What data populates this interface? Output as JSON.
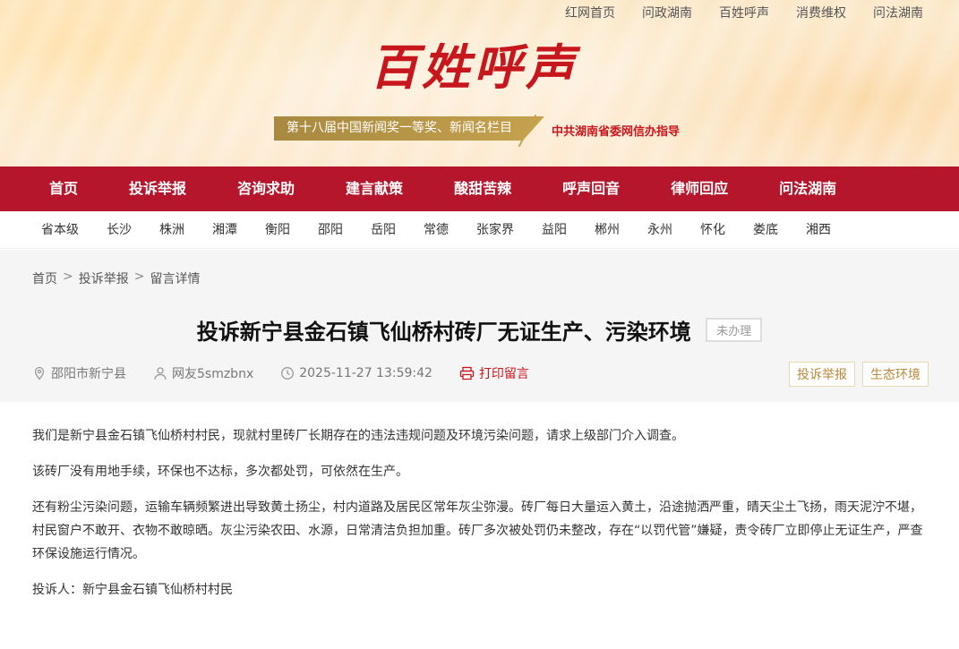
{
  "top_links": [
    "红网首页",
    "问政湖南",
    "百姓呼声",
    "消费维权",
    "问法湖南"
  ],
  "logo_title": "百姓呼声",
  "award_text": "第十八届中国新闻奖一等奖、新闻名栏目",
  "guide_text": "中共湖南省委网信办指导",
  "main_nav": [
    "首页",
    "投诉举报",
    "咨询求助",
    "建言献策",
    "酸甜苦辣",
    "呼声回音",
    "律师回应",
    "问法湖南"
  ],
  "city_nav": [
    "省本级",
    "长沙",
    "株洲",
    "湘潭",
    "衡阳",
    "邵阳",
    "岳阳",
    "常德",
    "张家界",
    "益阳",
    "郴州",
    "永州",
    "怀化",
    "娄底",
    "湘西"
  ],
  "breadcrumb": [
    "首页",
    "投诉举报",
    "留言详情"
  ],
  "breadcrumb_sep": ">",
  "article": {
    "title": "投诉新宁县金石镇飞仙桥村砖厂无证生产、污染环境",
    "status": "未办理",
    "location": "邵阳市新宁县",
    "user": "网友5smzbnx",
    "datetime": "2025-11-27 13:59:42",
    "print_label": "打印留言",
    "tags": [
      "投诉举报",
      "生态环境"
    ],
    "paragraphs": [
      "我们是新宁县金石镇飞仙桥村村民，现就村里砖厂长期存在的违法违规问题及环境污染问题，请求上级部门介入调查。",
      "该砖厂没有用地手续，环保也不达标，多次都处罚，可依然在生产。",
      "还有粉尘污染问题，运输车辆频繁进出导致黄土扬尘，村内道路及居民区常年灰尘弥漫。砖厂每日大量运入黄土，沿途抛洒严重，晴天尘土飞扬，雨天泥泞不堪，村民窗户不敢开、衣物不敢晾晒。灰尘污染农田、水源，日常清洁负担加重。砖厂多次被处罚仍未整改，存在“以罚代管”嫌疑，责令砖厂立即停止无证生产，严查环保设施运行情况。",
      "投诉人：新宁县金石镇飞仙桥村村民"
    ]
  },
  "colors": {
    "brand_red": "#b5162b",
    "title_red": "#c8161d",
    "gold": "#b8893a"
  }
}
